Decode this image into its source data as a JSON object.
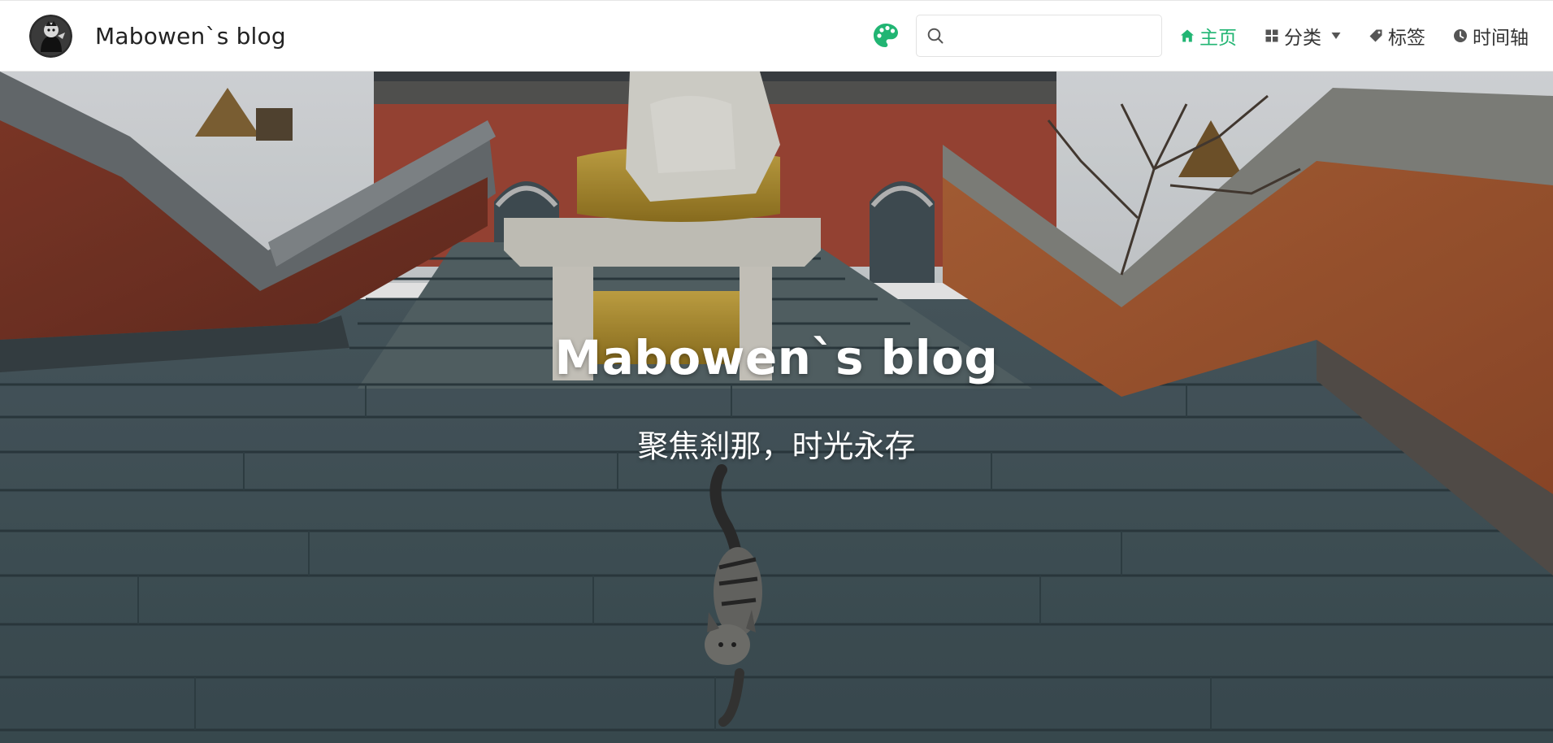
{
  "header": {
    "brand_title": "Mabowen`s blog",
    "search": {
      "placeholder": "",
      "value": ""
    },
    "nav": {
      "home": "主页",
      "categories": "分类",
      "tags": "标签",
      "timeline": "时间轴"
    }
  },
  "hero": {
    "title": "Mabowen`s blog",
    "subtitle": "聚焦刹那，时光永存"
  },
  "colors": {
    "accent": "#21b573",
    "palette_icon": "#21b573",
    "text": "#333333"
  },
  "icons": {
    "palette": "palette-icon",
    "search": "search-icon",
    "home": "home-icon",
    "categories": "grid-icon",
    "categories_dropdown": "caret-down-icon",
    "tags": "tag-icon",
    "timeline": "clock-icon"
  }
}
